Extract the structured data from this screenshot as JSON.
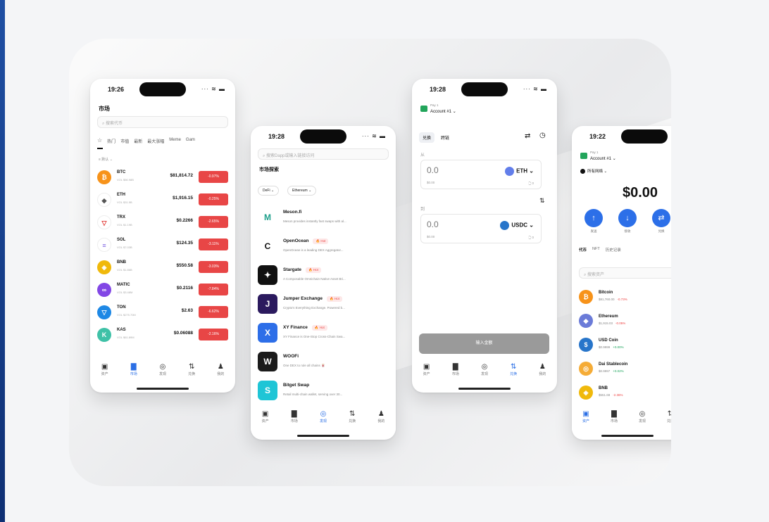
{
  "phone_market": {
    "time": "19:26",
    "title": "市场",
    "search_placeholder": "搜索代币",
    "filters": [
      "☆",
      "热门",
      "市值",
      "最新",
      "最大涨幅",
      "Meme",
      "Gam"
    ],
    "sort_label": "≡ 默认 ⌄",
    "rows": [
      {
        "sym": "BTC",
        "vol": "VOL $56.98B",
        "price": "$81,814.72",
        "change": "-0.97%",
        "color": "#f7931a",
        "icon": "₿"
      },
      {
        "sym": "ETH",
        "vol": "VOL $31.5B",
        "price": "$1,916.15",
        "change": "-0.25%",
        "color": "#6b7bd8",
        "icon": "◆"
      },
      {
        "sym": "TRX",
        "vol": "VOL $1.19B",
        "price": "$0.2266",
        "change": "-2.65%",
        "color": "#e0322d",
        "icon": "▽"
      },
      {
        "sym": "SOL",
        "vol": "VOL $7.03B",
        "price": "$124.35",
        "change": "-3.11%",
        "color": "#7b5fe0",
        "icon": "≡"
      },
      {
        "sym": "BNB",
        "vol": "VOL $1.86B",
        "price": "$550.58",
        "change": "-3.03%",
        "color": "#f0b90b",
        "icon": "◈"
      },
      {
        "sym": "MATIC",
        "vol": "VOL $3.48M",
        "price": "$0.2116",
        "change": "-7.84%",
        "color": "#8247e5",
        "icon": "∞"
      },
      {
        "sym": "TON",
        "vol": "VOL $275.70M",
        "price": "$2.63",
        "change": "-6.62%",
        "color": "#1e88e5",
        "icon": "▽"
      },
      {
        "sym": "KAS",
        "vol": "VOL $61.89M",
        "price": "$0.06088",
        "change": "-2.16%",
        "color": "#3fc1a7",
        "icon": "K"
      }
    ],
    "tabs": [
      "资产",
      "市场",
      "发现",
      "兑换",
      "我的"
    ],
    "tab_icons": [
      "▣",
      "▇",
      "◎",
      "⇅",
      "♟"
    ]
  },
  "phone_discover": {
    "time": "19:28",
    "search_placeholder": "搜索Dapp或输入链接访问",
    "title": "市场探索",
    "chips": [
      "DeFi ⌄",
      "Ethereum ⌄"
    ],
    "hot_label": "Hot",
    "dapps": [
      {
        "name": "Meson.fi",
        "desc": "Meson provides instantly fast swaps with al...",
        "color": "#1d9f8a",
        "icon": "M",
        "hot": false
      },
      {
        "name": "OpenOcean",
        "desc": "OpenOcean is a leading DEX Aggregator...",
        "color": "#111111",
        "icon": "C",
        "hot": true
      },
      {
        "name": "Stargate",
        "desc": "A Composable Omnichain Native Asset Bri...",
        "color": "#111111",
        "icon": "✦",
        "hot": true
      },
      {
        "name": "Jumper Exchange",
        "desc": "Crypto's Everything Exchange. Powered b...",
        "color": "#2b1a5e",
        "icon": "J",
        "hot": true
      },
      {
        "name": "XY Finance",
        "desc": "XY Finance is One-Stop Cross-Chain Swa...",
        "color": "#2d6ee8",
        "icon": "X",
        "hot": true
      },
      {
        "name": "WOOFi",
        "desc": "One DEX to rule all chains 🀄",
        "color": "#1b1b1b",
        "icon": "W",
        "hot": false
      },
      {
        "name": "Bitget Swap",
        "desc": "Retail multi-chain wallet, serving over 30...",
        "color": "#1fc5d6",
        "icon": "S",
        "hot": false
      }
    ],
    "tabs": [
      "资产",
      "市场",
      "发现",
      "兑换",
      "我的"
    ],
    "tab_icons": [
      "▣",
      "▇",
      "◎",
      "⇅",
      "♟"
    ]
  },
  "phone_swap": {
    "time": "19:28",
    "account_sub": "Pay 1",
    "account_name": "Account #1 ⌄",
    "tabs_top": [
      "兑换",
      "跨链"
    ],
    "from_label": "从",
    "to_label": "到",
    "from_amount": "0.0",
    "from_usd": "$0.00",
    "from_token": "ETH ⌄",
    "from_balance": "🗋 0",
    "to_amount": "0.0",
    "to_usd": "$0.00",
    "to_token": "USDC ⌄",
    "to_balance": "🗋 0",
    "cta": "输入金额",
    "tabs": [
      "资产",
      "市场",
      "发现",
      "兑换",
      "我的"
    ],
    "tab_icons": [
      "▣",
      "▇",
      "◎",
      "⇅",
      "♟"
    ]
  },
  "phone_wallet": {
    "time": "19:22",
    "account_sub": "Pay 1",
    "account_name": "Account #1 ⌄",
    "network": "所有网络 ⌄",
    "balance": "$0.00",
    "actions": [
      {
        "icon": "↑",
        "label": "发送"
      },
      {
        "icon": "↓",
        "label": "接收"
      },
      {
        "icon": "⇄",
        "label": "兑换"
      }
    ],
    "tabs_top": [
      "代币",
      "NFT",
      "历史记录"
    ],
    "search_placeholder": "搜索资产",
    "assets": [
      {
        "name": "Bitcoin",
        "price": "$81,760.00",
        "change": "-0.73%",
        "color": "#f7931a",
        "icon": "₿",
        "positive": false
      },
      {
        "name": "Ethereum",
        "price": "$1,915.03",
        "change": "-0.05%",
        "color": "#6b7bd8",
        "icon": "◆",
        "positive": false
      },
      {
        "name": "USD Coin",
        "price": "$0.9999",
        "change": "+0.00%",
        "color": "#2775ca",
        "icon": "$",
        "positive": true
      },
      {
        "name": "Dai Stablecoin",
        "price": "$0.9997",
        "change": "+0.02%",
        "color": "#f5ac37",
        "icon": "◎",
        "positive": true
      },
      {
        "name": "BNB",
        "price": "$551.68",
        "change": "-2.36%",
        "color": "#f0b90b",
        "icon": "◈",
        "positive": false
      }
    ],
    "tabs": [
      "资产",
      "市场",
      "发现",
      "兑换"
    ],
    "tab_icons": [
      "▣",
      "▇",
      "◎",
      "⇅"
    ]
  }
}
